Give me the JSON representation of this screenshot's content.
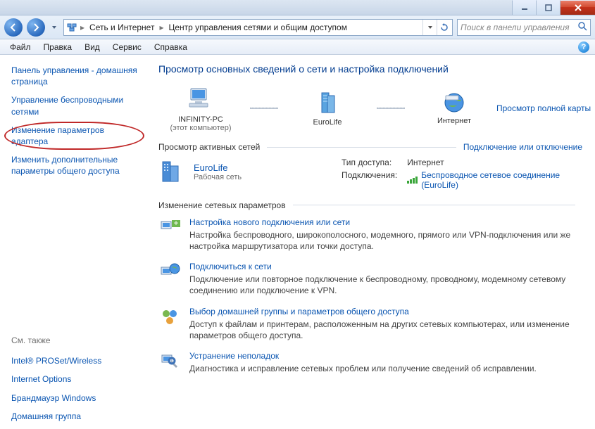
{
  "window_buttons": {
    "min": "minimize",
    "max": "maximize",
    "close": "close"
  },
  "address": {
    "segments": [
      "Сеть и Интернет",
      "Центр управления сетями и общим доступом"
    ]
  },
  "search": {
    "placeholder": "Поиск в панели управления"
  },
  "menu": {
    "file": "Файл",
    "edit": "Правка",
    "view": "Вид",
    "service": "Сервис",
    "help": "Справка"
  },
  "sidebar": {
    "items": [
      {
        "label": "Панель управления - домашняя страница"
      },
      {
        "label": "Управление беспроводными сетями"
      },
      {
        "label": "Изменение параметров адаптера",
        "circled": true
      },
      {
        "label": "Изменить дополнительные параметры общего доступа"
      }
    ],
    "see_also_head": "См. также",
    "see_also": [
      "Intel® PROSet/Wireless",
      "Internet Options",
      "Брандмауэр Windows",
      "Домашняя группа"
    ]
  },
  "main": {
    "heading": "Просмотр основных сведений о сети и настройка подключений",
    "full_map_link": "Просмотр полной карты",
    "nodes": {
      "pc": {
        "name": "INFINITY-PC",
        "sub": "(этот компьютер)"
      },
      "network": {
        "name": "EuroLife"
      },
      "internet": {
        "name": "Интернет"
      }
    },
    "active_networks": {
      "title": "Просмотр активных сетей",
      "connect_link": "Подключение или отключение",
      "network": {
        "name": "EuroLife",
        "kind": "Рабочая сеть",
        "access_key": "Тип доступа:",
        "access_val": "Интернет",
        "conn_key": "Подключения:",
        "conn_val": "Беспроводное сетевое соединение (EuroLife)"
      }
    },
    "change_settings": {
      "title": "Изменение сетевых параметров",
      "tasks": [
        {
          "title": "Настройка нового подключения или сети",
          "desc": "Настройка беспроводного, широкополосного, модемного, прямого или VPN-подключения или же настройка маршрутизатора или точки доступа."
        },
        {
          "title": "Подключиться к сети",
          "desc": "Подключение или повторное подключение к беспроводному, проводному, модемному сетевому соединению или подключение к VPN."
        },
        {
          "title": "Выбор домашней группы и параметров общего доступа",
          "desc": "Доступ к файлам и принтерам, расположенным на других сетевых компьютерах, или изменение параметров общего доступа."
        },
        {
          "title": "Устранение неполадок",
          "desc": "Диагностика и исправление сетевых проблем или получение сведений об исправлении."
        }
      ]
    }
  }
}
